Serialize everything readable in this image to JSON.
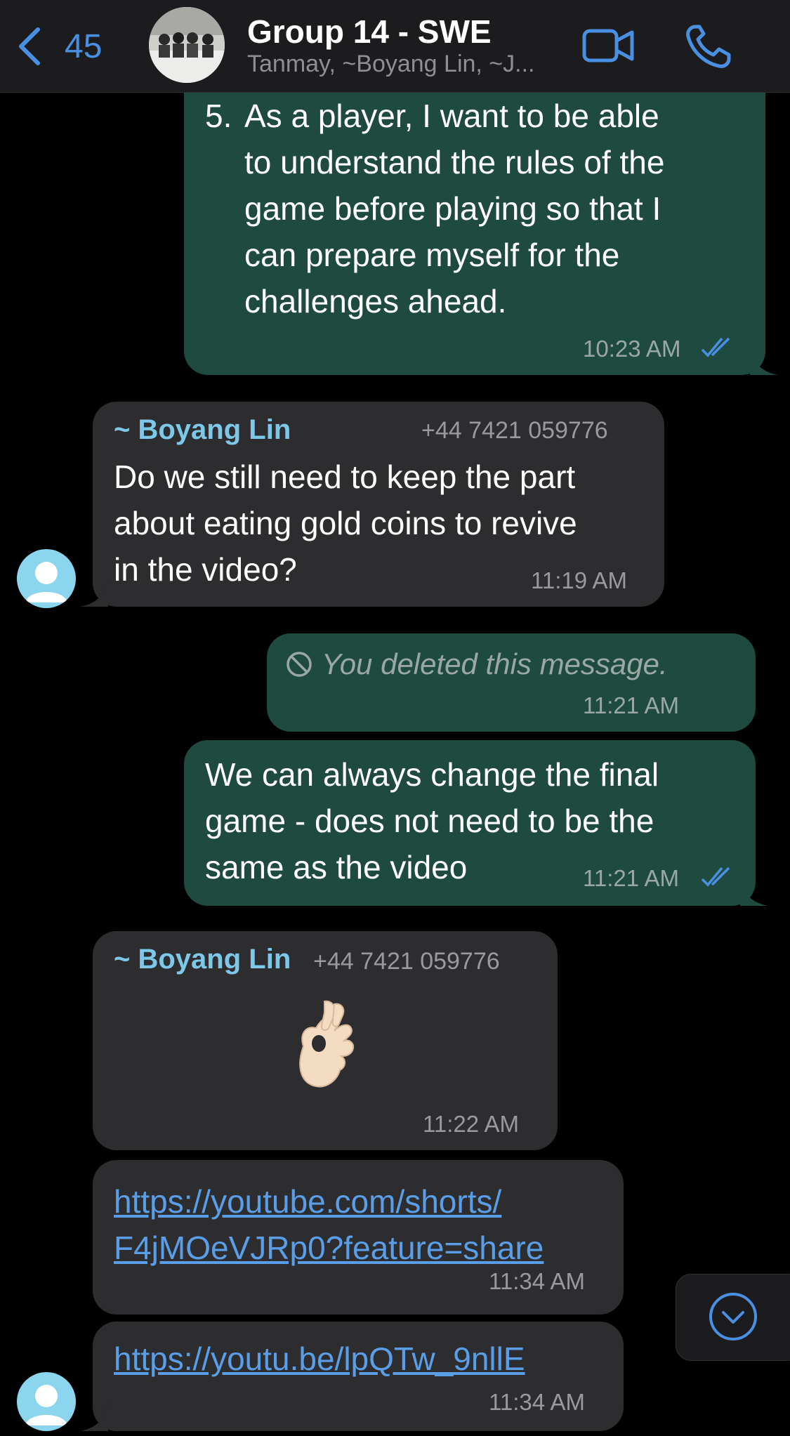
{
  "header": {
    "back_count": "45",
    "title": "Group 14 - SWE",
    "subtitle": "Tanmay, ~Boyang Lin, ~J...",
    "icons": [
      "chevron-left-icon",
      "video-call-icon",
      "phone-call-icon"
    ],
    "accent_color": "#4a90e2"
  },
  "messages": [
    {
      "direction": "outgoing",
      "list_number": "5.",
      "lines": [
        "As a player, I want to be able",
        "to understand the rules of the",
        "game before playing so that I",
        "can prepare myself for the",
        "challenges ahead."
      ],
      "time": "10:23 AM",
      "status": "read"
    },
    {
      "direction": "incoming",
      "sender": "~ Boyang Lin",
      "phone": "+44 7421 059776",
      "lines": [
        "Do we still need to keep the part",
        "about eating gold coins to revive",
        "in the video?"
      ],
      "time": "11:19 AM"
    },
    {
      "direction": "outgoing",
      "deleted_text": "You deleted this message.",
      "time": "11:21 AM"
    },
    {
      "direction": "outgoing",
      "lines": [
        "We can always change the final",
        "game - does not need to be the",
        "same as the video"
      ],
      "time": "11:21 AM",
      "status": "read"
    },
    {
      "direction": "incoming",
      "sender": "~ Boyang Lin",
      "phone": "+44 7421 059776",
      "emoji": "ok-hand",
      "time": "11:22 AM"
    },
    {
      "direction": "incoming",
      "link_lines": [
        "https://youtube.com/shorts/",
        "F4jMOeVJRp0?feature=share"
      ],
      "time": "11:34 AM"
    },
    {
      "direction": "incoming",
      "link_lines": [
        "https://youtu.be/lpQTw_9nllE"
      ],
      "time": "11:34 AM"
    }
  ],
  "colors": {
    "outgoing_bubble": "#1f4a40",
    "incoming_bubble": "#2d2d30",
    "sender_name": "#7dc8e8",
    "link": "#5b9ee8",
    "read_ticks": "#4a90e2"
  }
}
